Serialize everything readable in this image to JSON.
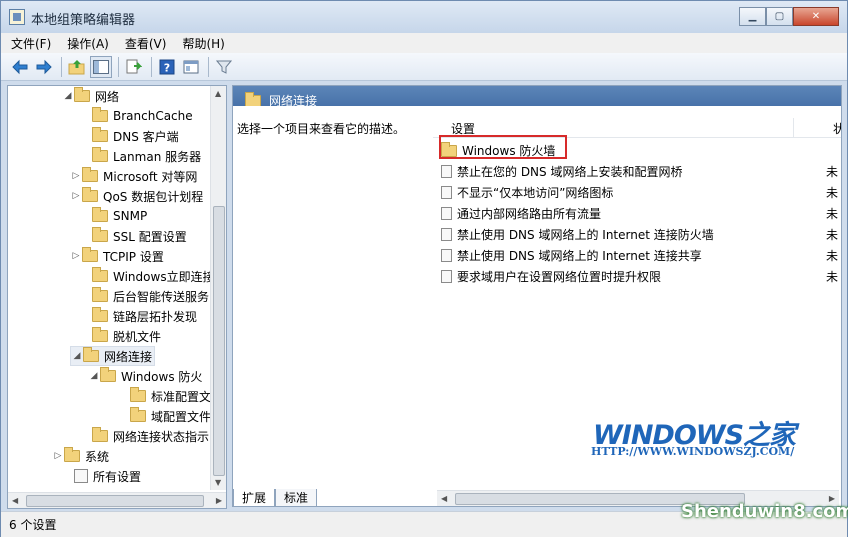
{
  "window": {
    "title": "本地组策略编辑器"
  },
  "menu": [
    "文件(F)",
    "操作(A)",
    "查看(V)",
    "帮助(H)"
  ],
  "toolbar": {
    "icons": [
      "back-icon",
      "forward-icon",
      "up-folder-icon",
      "show-hide-tree-icon",
      "export-icon",
      "help-icon",
      "properties-icon",
      "filter-icon"
    ]
  },
  "tree": {
    "items": [
      {
        "label": "网络",
        "tri": "◢",
        "kind": "folder"
      },
      {
        "label": "BranchCache",
        "tri": "",
        "kind": "folder"
      },
      {
        "label": "DNS 客户端",
        "tri": "",
        "kind": "folder"
      },
      {
        "label": "Lanman 服务器",
        "tri": "",
        "kind": "folder"
      },
      {
        "label": "Microsoft 对等网",
        "tri": "▷",
        "kind": "folder"
      },
      {
        "label": "QoS 数据包计划程",
        "tri": "▷",
        "kind": "folder"
      },
      {
        "label": "SNMP",
        "tri": "",
        "kind": "folder"
      },
      {
        "label": "SSL 配置设置",
        "tri": "",
        "kind": "folder"
      },
      {
        "label": "TCPIP 设置",
        "tri": "▷",
        "kind": "folder"
      },
      {
        "label": "Windows立即连接",
        "tri": "",
        "kind": "folder"
      },
      {
        "label": "后台智能传送服务",
        "tri": "",
        "kind": "folder"
      },
      {
        "label": "链路层拓扑发现",
        "tri": "",
        "kind": "folder"
      },
      {
        "label": "脱机文件",
        "tri": "",
        "kind": "folder"
      },
      {
        "label": "网络连接",
        "tri": "◢",
        "kind": "folder"
      },
      {
        "label": "Windows 防火",
        "tri": "◢",
        "kind": "folder"
      },
      {
        "label": "标准配置文",
        "tri": "",
        "kind": "folder"
      },
      {
        "label": "域配置文件",
        "tri": "",
        "kind": "folder"
      },
      {
        "label": "网络连接状态指示",
        "tri": "",
        "kind": "folder"
      },
      {
        "label": "系统",
        "tri": "▷",
        "kind": "folder"
      },
      {
        "label": "所有设置",
        "tri": "",
        "kind": "page"
      }
    ]
  },
  "right": {
    "header_title": "网络连接",
    "description": "选择一个项目来查看它的描述。",
    "col_setting": "设置",
    "col_state": "状",
    "rows": [
      {
        "label": "Windows 防火墙",
        "kind": "folder",
        "state": ""
      },
      {
        "label": "禁止在您的 DNS 域网络上安装和配置网桥",
        "kind": "setting",
        "state": "未"
      },
      {
        "label": "不显示“仅本地访问”网络图标",
        "kind": "setting",
        "state": "未"
      },
      {
        "label": "通过内部网络路由所有流量",
        "kind": "setting",
        "state": "未"
      },
      {
        "label": "禁止使用 DNS 域网络上的 Internet 连接防火墙",
        "kind": "setting",
        "state": "未"
      },
      {
        "label": "禁止使用 DNS 域网络上的 Internet 连接共享",
        "kind": "setting",
        "state": "未"
      },
      {
        "label": "要求域用户在设置网络位置时提升权限",
        "kind": "setting",
        "state": "未"
      }
    ]
  },
  "tabs": [
    "扩展",
    "标准"
  ],
  "status": "6 个设置",
  "watermark": {
    "logo": "WINDOWS之家",
    "url": "HTTP://WWW.WINDOWSZJ.COM/",
    "site": "Shenduwin8.com"
  }
}
